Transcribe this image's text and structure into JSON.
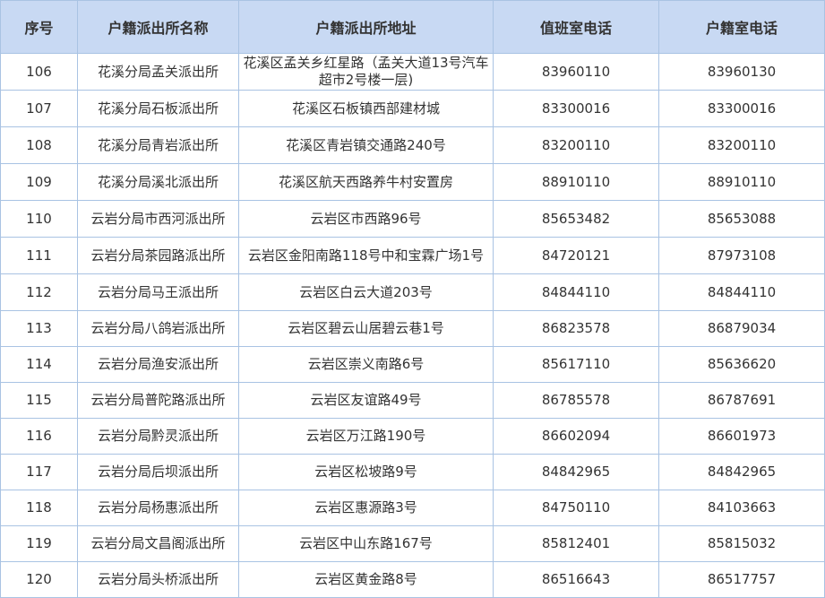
{
  "table": {
    "headers": [
      "序号",
      "户籍派出所名称",
      "户籍派出所地址",
      "值班室电话",
      "户籍室电话"
    ],
    "rows": [
      [
        "106",
        "花溪分局孟关派出所",
        "花溪区孟关乡红星路（孟关大道13号汽车超市2号楼一层)",
        "83960110",
        "83960130"
      ],
      [
        "107",
        "花溪分局石板派出所",
        "花溪区石板镇西部建材城",
        "83300016",
        "83300016"
      ],
      [
        "108",
        "花溪分局青岩派出所",
        "花溪区青岩镇交通路240号",
        "83200110",
        "83200110"
      ],
      [
        "109",
        "花溪分局溪北派出所",
        "花溪区航天西路养牛村安置房",
        "88910110",
        "88910110"
      ],
      [
        "110",
        "云岩分局市西河派出所",
        "云岩区市西路96号",
        "85653482",
        "85653088"
      ],
      [
        "111",
        "云岩分局茶园路派出所",
        "云岩区金阳南路118号中和宝霖广场1号",
        "84720121",
        "87973108"
      ],
      [
        "112",
        "云岩分局马王派出所",
        "云岩区白云大道203号",
        "84844110",
        "84844110"
      ],
      [
        "113",
        "云岩分局八鸽岩派出所",
        "云岩区碧云山居碧云巷1号",
        "86823578",
        "86879034"
      ],
      [
        "114",
        "云岩分局渔安派出所",
        "云岩区崇义南路6号",
        "85617110",
        "85636620"
      ],
      [
        "115",
        "云岩分局普陀路派出所",
        "云岩区友谊路49号",
        "86785578",
        "86787691"
      ],
      [
        "116",
        "云岩分局黔灵派出所",
        "云岩区万江路190号",
        "86602094",
        "86601973"
      ],
      [
        "117",
        "云岩分局后坝派出所",
        "云岩区松坡路9号",
        "84842965",
        "84842965"
      ],
      [
        "118",
        "云岩分局杨惠派出所",
        "云岩区惠源路3号",
        "84750110",
        "84103663"
      ],
      [
        "119",
        "云岩分局文昌阁派出所",
        "云岩区中山东路167号",
        "85812401",
        "85815032"
      ],
      [
        "120",
        "云岩分局头桥派出所",
        "云岩区黄金路8号",
        "86516643",
        "86517757"
      ]
    ]
  }
}
